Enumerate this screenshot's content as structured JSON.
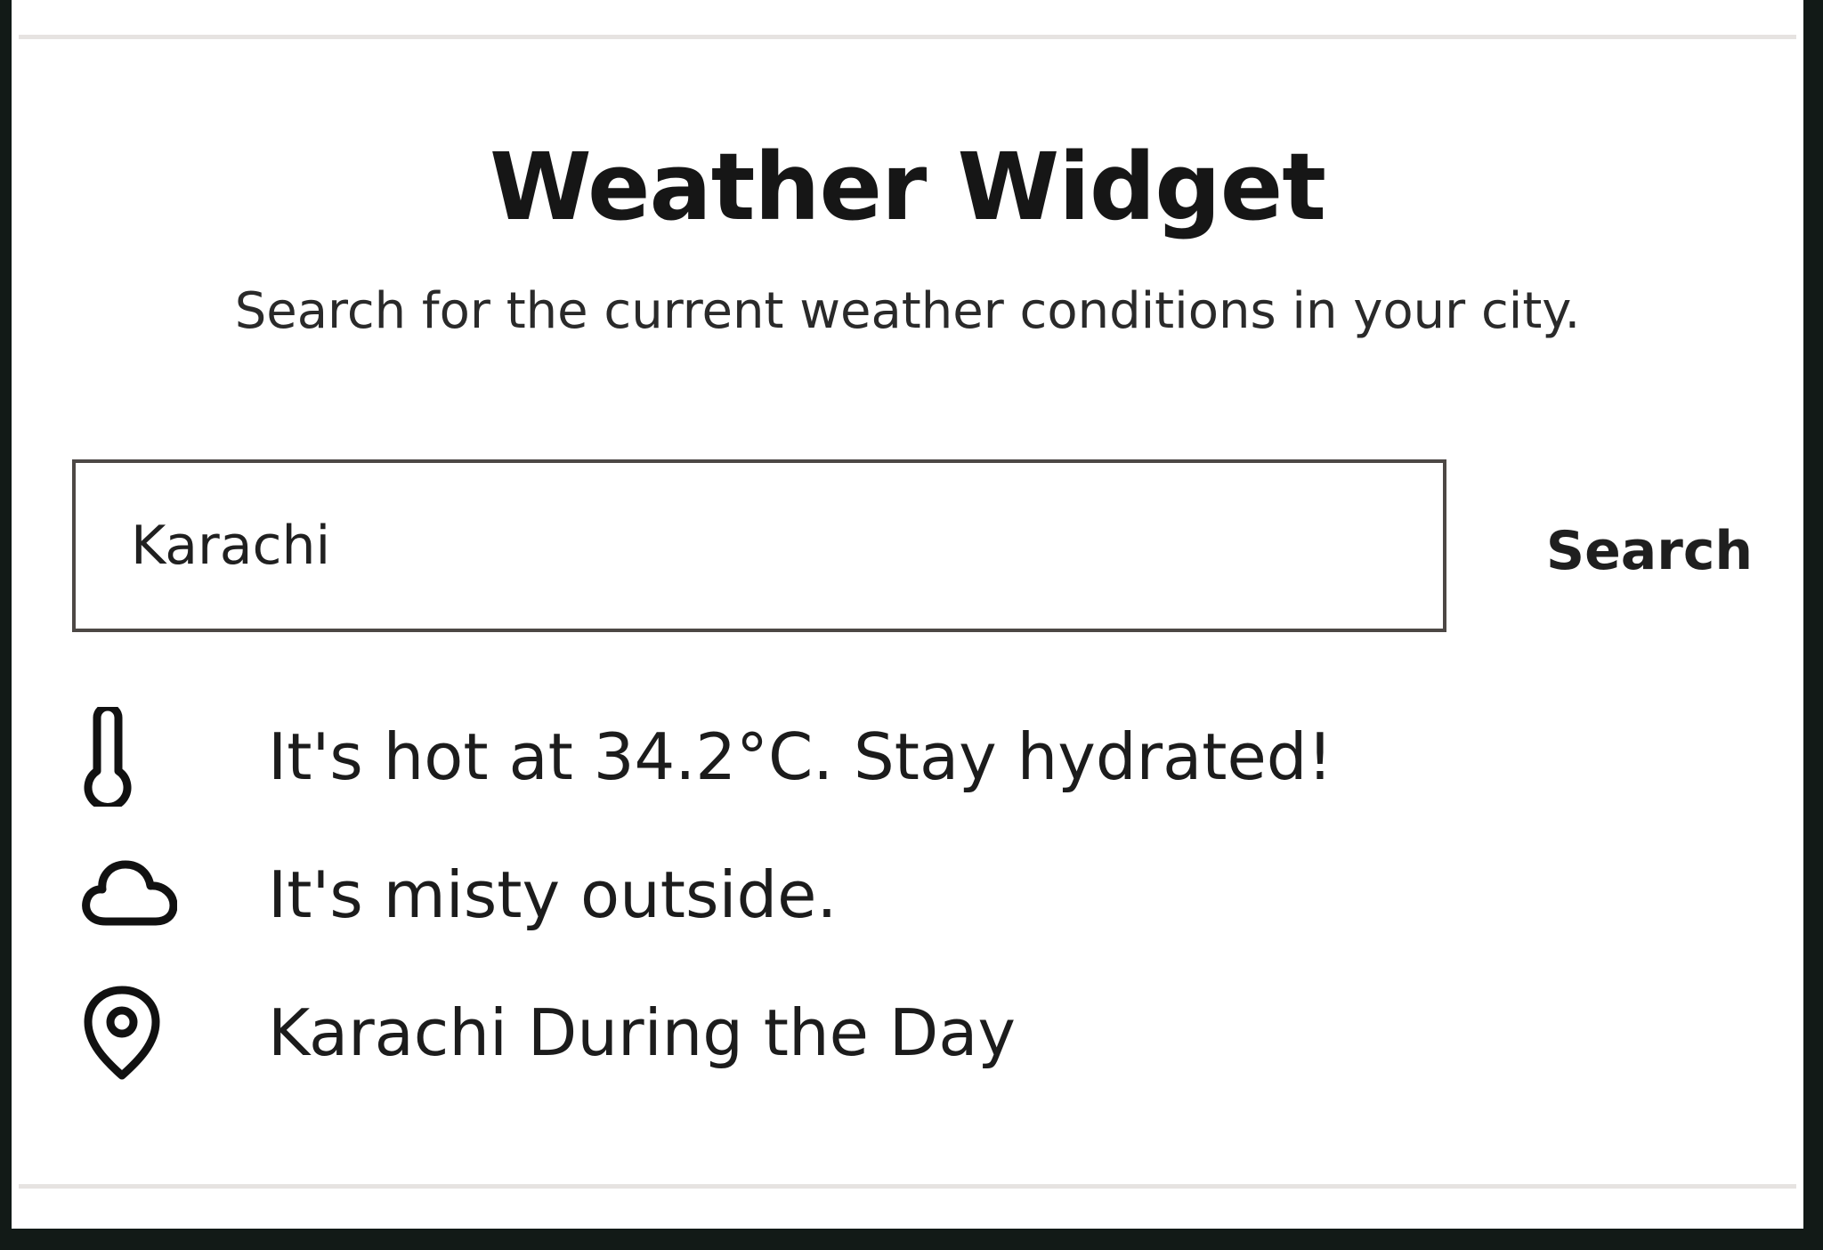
{
  "widget": {
    "title": "Weather Widget",
    "subtitle": "Search for the current weather conditions in your city."
  },
  "search": {
    "value": "Karachi",
    "placeholder": "",
    "button_label": "Search"
  },
  "results": {
    "temperature": {
      "icon": "thermometer-icon",
      "text": "It's hot at 34.2°C. Stay hydrated!"
    },
    "condition": {
      "icon": "cloud-icon",
      "text": "It's misty outside."
    },
    "location": {
      "icon": "location-pin-icon",
      "text": "Karachi During the Day"
    }
  },
  "colors": {
    "background": "#ffffff",
    "text": "#1c1c1c",
    "input_border": "#4d4845",
    "divider": "#e6e3e1",
    "outer_frame": "#121a17"
  }
}
